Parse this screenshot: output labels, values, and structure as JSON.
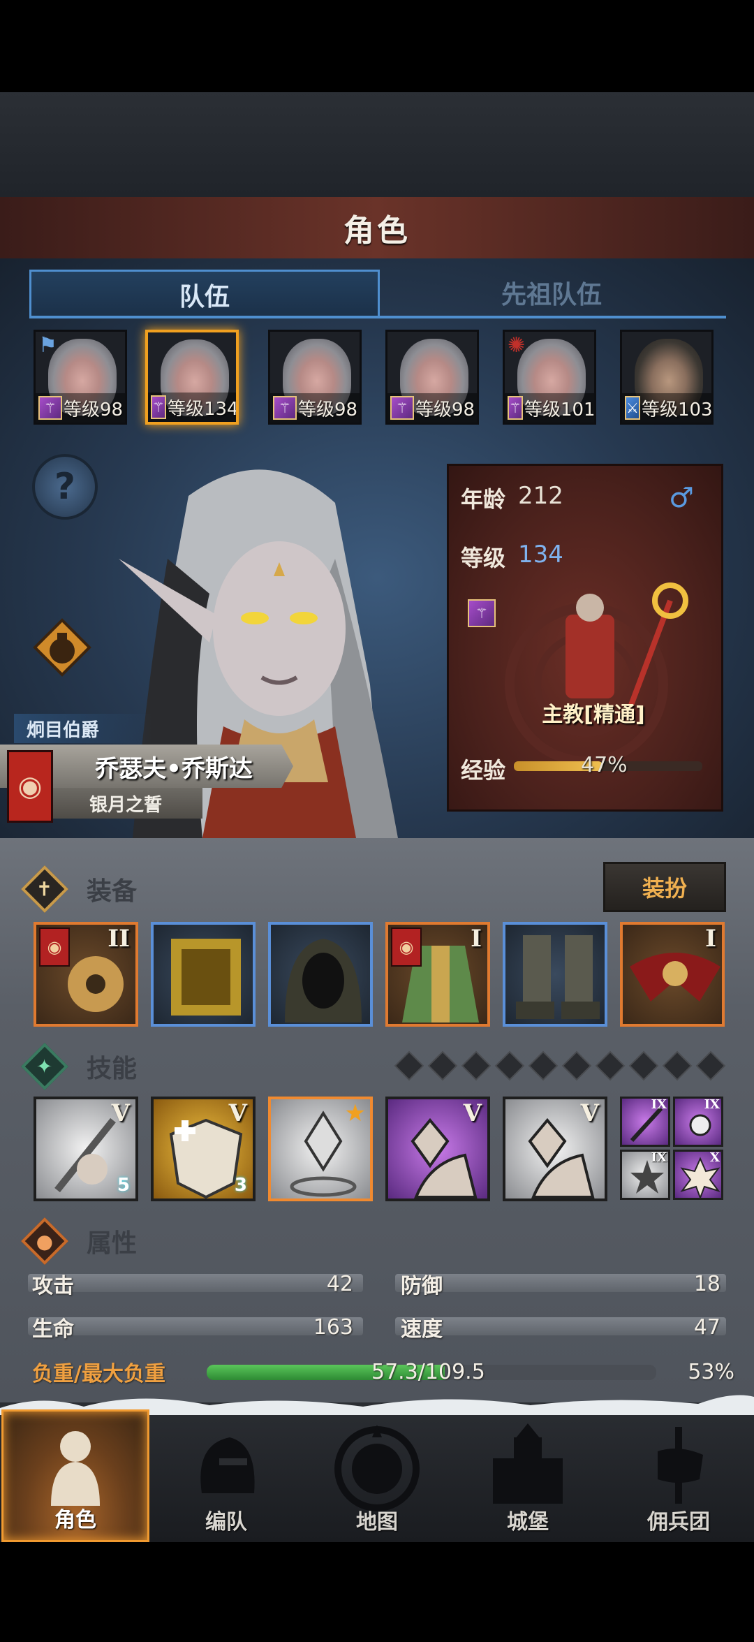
{
  "title": "角色",
  "tabs": {
    "team": "队伍",
    "ancestor_team": "先祖队伍"
  },
  "heroes": [
    {
      "level": "等级98",
      "class": "priest",
      "selected": false,
      "flag": true
    },
    {
      "level": "等级134",
      "class": "priest",
      "selected": true
    },
    {
      "level": "等级98",
      "class": "priest",
      "selected": false
    },
    {
      "level": "等级98",
      "class": "priest",
      "selected": false
    },
    {
      "level": "等级101",
      "class": "priest",
      "selected": false
    },
    {
      "level": "等级103",
      "class": "swordsman",
      "selected": false
    }
  ],
  "character": {
    "title": "炯目伯爵",
    "name": "乔瑟夫•乔斯达",
    "faction": "银月之誓",
    "age_label": "年龄",
    "age": "212",
    "gender_icon": "male-icon",
    "level_label": "等级",
    "level": "134",
    "class_name": "主教[精通]",
    "exp_label": "经验",
    "exp_percent": "47%",
    "exp_fraction": 0.47
  },
  "equipment": {
    "title": "装备",
    "dress_button": "装扮",
    "slots": [
      {
        "name": "staff",
        "rarity": "orange",
        "tier": "II",
        "banner": true
      },
      {
        "name": "tome",
        "rarity": "blue",
        "tier": "",
        "banner": false
      },
      {
        "name": "hood",
        "rarity": "blue",
        "tier": "",
        "banner": false
      },
      {
        "name": "robe",
        "rarity": "orange",
        "tier": "I",
        "banner": true
      },
      {
        "name": "boots",
        "rarity": "blue",
        "tier": "",
        "banner": false
      },
      {
        "name": "amulet",
        "rarity": "orange",
        "tier": "I",
        "banner": false
      }
    ]
  },
  "skills": {
    "title": "技能",
    "big": [
      {
        "tier": "V",
        "badge": "5",
        "style": "white"
      },
      {
        "tier": "V",
        "badge": "3",
        "style": "gold"
      },
      {
        "tier": "",
        "badge": "",
        "style": "white",
        "star": true
      },
      {
        "tier": "V",
        "badge": "",
        "style": "purple"
      },
      {
        "tier": "V",
        "badge": "",
        "style": "white"
      }
    ],
    "small": [
      {
        "tier": "IX",
        "style": "purple"
      },
      {
        "tier": "IX",
        "style": "purple"
      },
      {
        "tier": "IX",
        "style": "white"
      },
      {
        "tier": "X",
        "style": "purple"
      }
    ]
  },
  "attributes": {
    "title": "属性",
    "attack_label": "攻击",
    "attack": "42",
    "defense_label": "防御",
    "defense": "18",
    "hp_label": "生命",
    "hp": "163",
    "speed_label": "速度",
    "speed": "47",
    "load_label": "负重/最大负重",
    "load": "57.3/109.5",
    "load_percent": "53%",
    "load_fraction": 0.53
  },
  "nav": {
    "character": "角色",
    "formation": "编队",
    "map": "地图",
    "castle": "城堡",
    "mercenary": "佣兵团"
  },
  "colors": {
    "accent_orange": "#f09a30",
    "tab_blue": "#4f8fcf",
    "panel_red": "#4a211c"
  }
}
